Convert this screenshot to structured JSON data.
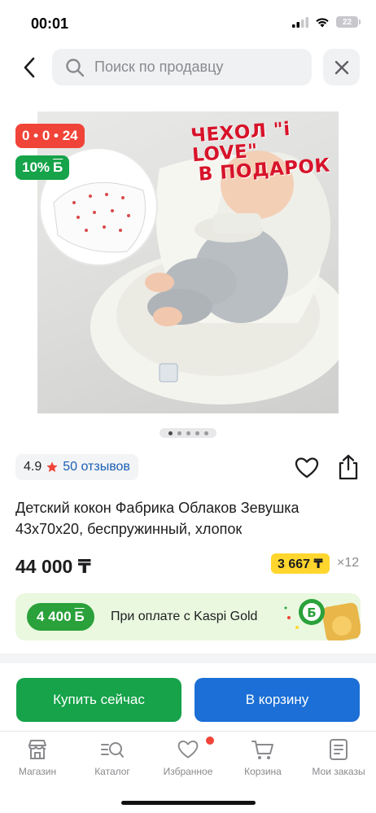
{
  "status_bar": {
    "time": "00:01",
    "battery": "22"
  },
  "header": {
    "search_placeholder": "Поиск по продавцу"
  },
  "product": {
    "timer_badge": "0 • 0 • 24",
    "discount_badge": "10%",
    "discount_currency": "Б",
    "image_promo_line1": "ЧЕХОЛ \"i LOVE\"",
    "image_promo_line2": "В ПОДАРОК",
    "rating": "4.9",
    "reviews": "50 отзывов",
    "title": "Детский кокон Фабрика Облаков Зевушка 43х70х20, беспружинный, хлопок",
    "price": "44 000 ₸",
    "installment_price": "3 667 ₸",
    "installment_months": "×12"
  },
  "kaspi": {
    "bonus": "4 400",
    "bonus_currency": "Б",
    "text": "При оплате с Kaspi Gold"
  },
  "actions": {
    "buy_now": "Купить сейчас",
    "add_to_cart": "В корзину"
  },
  "tabbar": {
    "items": [
      {
        "label": "Магазин",
        "icon": "shop-icon"
      },
      {
        "label": "Каталог",
        "icon": "catalog-search-icon"
      },
      {
        "label": "Избранное",
        "icon": "heart-icon"
      },
      {
        "label": "Корзина",
        "icon": "cart-icon"
      },
      {
        "label": "Мои заказы",
        "icon": "orders-icon"
      }
    ]
  },
  "colors": {
    "green": "#16a34a",
    "blue": "#1b6fd6",
    "red": "#f04438",
    "yellow": "#ffd62e",
    "link": "#1a5fb4"
  }
}
